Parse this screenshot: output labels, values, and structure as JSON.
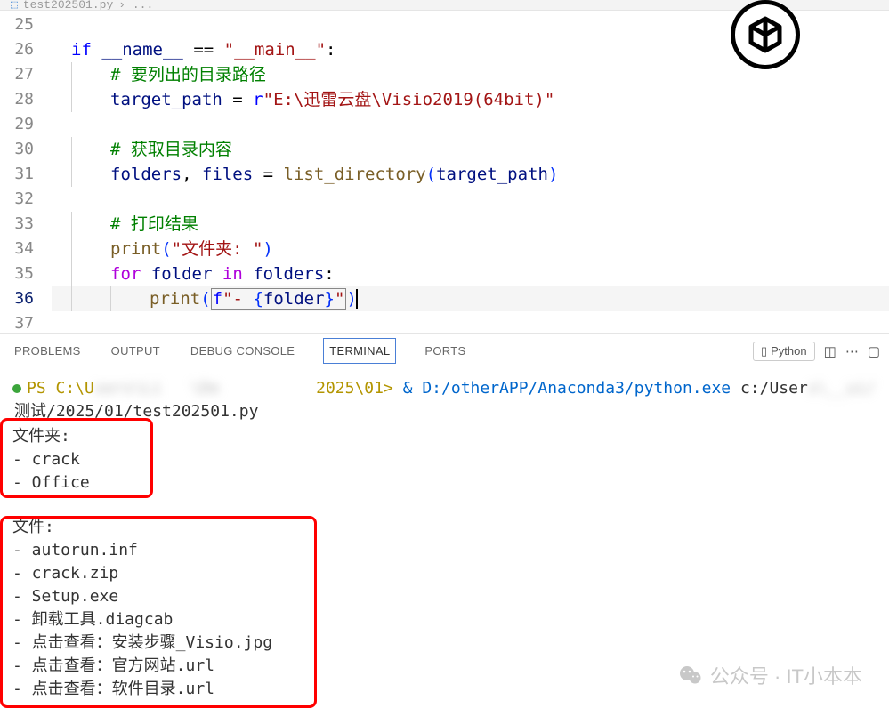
{
  "tab": {
    "filename": "test202501.py",
    "trail": "› ..."
  },
  "gutter": {
    "start": 25,
    "end": 37,
    "active": 36
  },
  "code": {
    "lines": [
      {
        "n": 25,
        "html": ""
      },
      {
        "n": 26,
        "html": "<span class='kw2'>if</span> <span class='var'>__name__</span> <span class='op'>==</span> <span class='str'>\"__main__\"</span>:"
      },
      {
        "n": 27,
        "html": "    <span class='cm'># 要列出的目录路径</span>"
      },
      {
        "n": 28,
        "html": "    <span class='var'>target_path</span> = <span class='kw2'>r</span><span class='str'>\"E:\\迅雷云盘\\Visio2019(64bit)\"</span>"
      },
      {
        "n": 29,
        "html": ""
      },
      {
        "n": 30,
        "html": "    <span class='cm'># 获取目录内容</span>"
      },
      {
        "n": 31,
        "html": "    <span class='var'>folders</span>, <span class='var'>files</span> = <span class='fn'>list_directory</span><span class='paren'>(</span><span class='var'>target_path</span><span class='paren'>)</span>"
      },
      {
        "n": 32,
        "html": ""
      },
      {
        "n": 33,
        "html": "    <span class='cm'># 打印结果</span>"
      },
      {
        "n": 34,
        "html": "    <span class='fn'>print</span><span class='paren'>(</span><span class='str'>\"文件夹: \"</span><span class='paren'>)</span>"
      },
      {
        "n": 35,
        "html": "    <span class='kw'>for</span> <span class='var'>folder</span> <span class='kw'>in</span> <span class='var'>folders</span>:"
      },
      {
        "n": 36,
        "html": "        <span class='fn'>print</span><span class='paren'>(</span><span style='border:1px solid #888; padding:0 1px'><span class='kw2'>f</span><span class='str'>\"- </span><span class='bracket'>{</span><span class='var'>folder</span><span class='bracket'>}</span><span class='str'>\"</span></span><span class='paren'>)</span><span class='cursor'></span>"
      },
      {
        "n": 37,
        "html": ""
      }
    ]
  },
  "panel": {
    "tabs": [
      "PROBLEMS",
      "OUTPUT",
      "DEBUG CONSOLE",
      "TERMINAL",
      "PORTS"
    ],
    "active": "TERMINAL",
    "launcher": "Python"
  },
  "terminal": {
    "prompt_prefix": "PS C:\\U",
    "prompt_blur": "sers\\Li   \\De          ",
    "prompt_mid": "2025\\01> ",
    "amp": "&",
    "exe": "D:/otherAPP/Anaconda3/python.exe",
    "script_pre": " c:/User",
    "script_blur": "s\\__ui/",
    "script2": "测试/2025/01/test202501.py",
    "folders_header": "文件夹:",
    "folders": [
      "crack",
      "Office"
    ],
    "files_header": "文件:",
    "files": [
      "autorun.inf",
      "crack.zip",
      "Setup.exe",
      "卸载工具.diagcab",
      "点击查看：安装步骤_Visio.jpg",
      "点击查看：官方网站.url",
      "点击查看：软件目录.url"
    ]
  },
  "watermark": {
    "text": "公众号 · IT小本本"
  }
}
